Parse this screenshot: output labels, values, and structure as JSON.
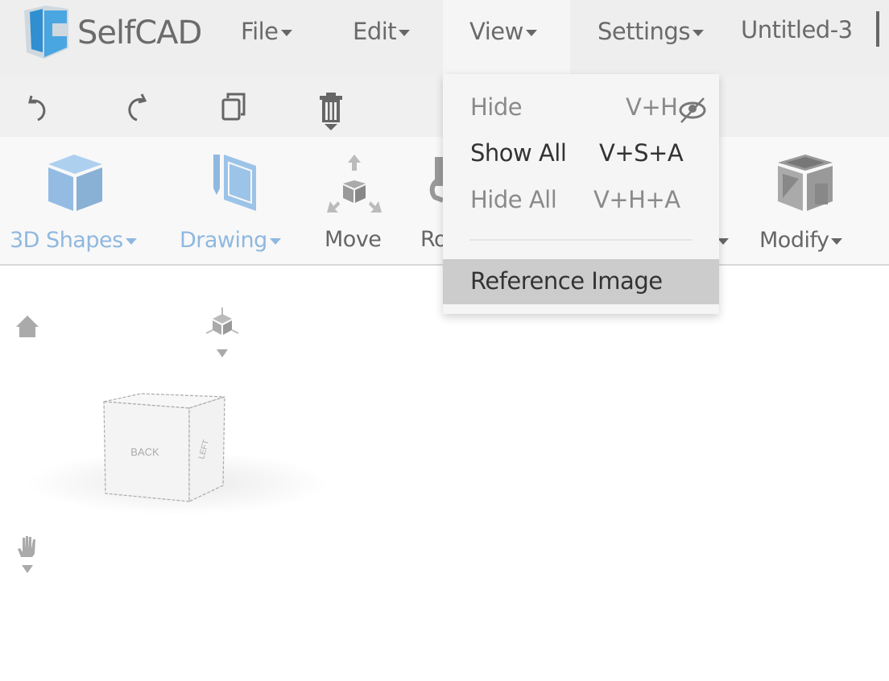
{
  "app": {
    "name": "SelfCAD",
    "document_title": "Untitled-3"
  },
  "menubar": {
    "items": [
      {
        "label": "File"
      },
      {
        "label": "Edit"
      },
      {
        "label": "View"
      },
      {
        "label": "Settings"
      }
    ]
  },
  "toolbar": {
    "icons": [
      "undo-icon",
      "redo-icon",
      "copy-icon",
      "delete-icon"
    ]
  },
  "ribbon": {
    "items": [
      {
        "label": "3D Shapes",
        "color": "#8fb8e0"
      },
      {
        "label": "Drawing",
        "color": "#8fb8e0"
      },
      {
        "label": "Move"
      },
      {
        "label": "Ro"
      },
      {
        "label": "Modify"
      }
    ]
  },
  "view_menu": {
    "items": [
      {
        "label": "Hide",
        "shortcut": "V+H",
        "state": "disabled"
      },
      {
        "label": "Show All",
        "shortcut": "V+S+A",
        "state": "enabled"
      },
      {
        "label": "Hide All",
        "shortcut": "V+H+A",
        "state": "disabled"
      },
      {
        "label": "Reference Image",
        "state": "highlighted"
      }
    ]
  },
  "viewport": {
    "cube_faces": {
      "front": "BACK",
      "side": "LEFT"
    }
  }
}
